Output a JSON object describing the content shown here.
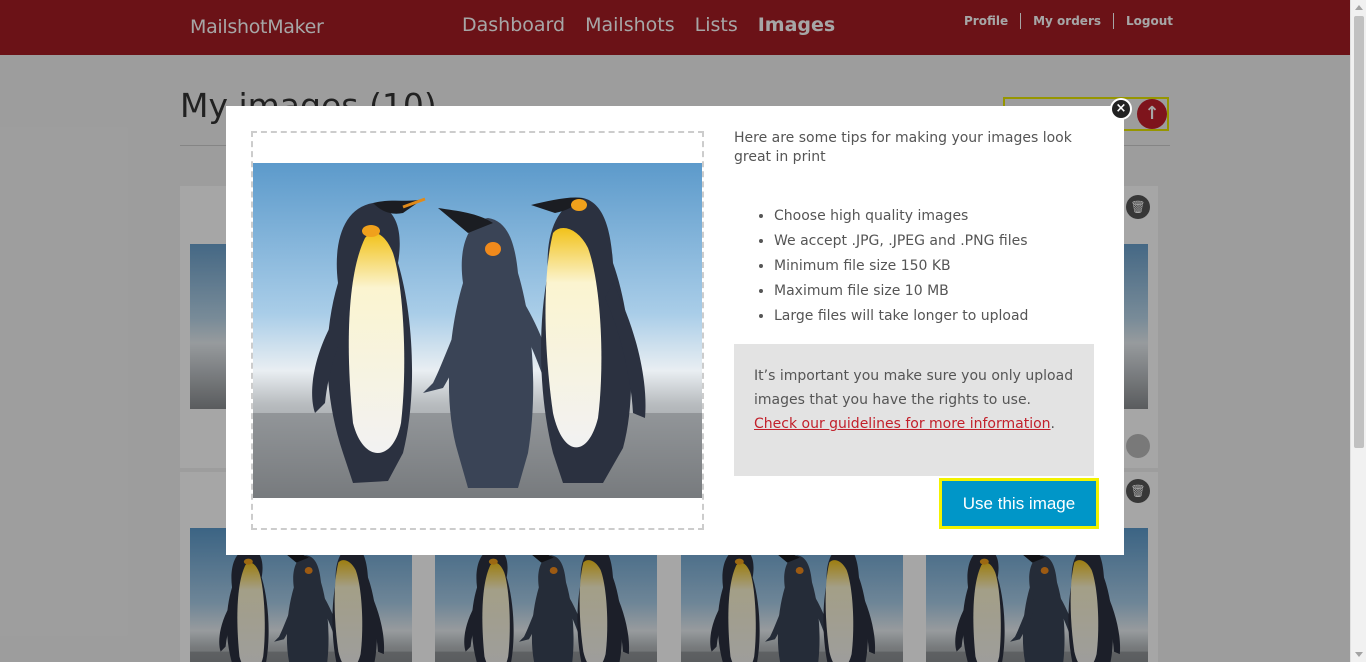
{
  "header": {
    "brand": "MailshotMaker",
    "nav": [
      {
        "label": "Dashboard",
        "active": false
      },
      {
        "label": "Mailshots",
        "active": false
      },
      {
        "label": "Lists",
        "active": false
      },
      {
        "label": "Images",
        "active": true
      }
    ],
    "user_links": [
      "Profile",
      "My orders",
      "Logout"
    ]
  },
  "page": {
    "title": "My images (10)",
    "upload_icon": "upload-arrow-icon",
    "delete_icon": "trash-icon"
  },
  "modal": {
    "close_label": "×",
    "tips_heading": "Here are some tips for making your images look great in print",
    "tips": [
      "Choose high quality images",
      "We accept .JPG, .JPEG and .PNG files",
      "Minimum file size 150 KB",
      "Maximum file size 10 MB",
      "Large files will take longer to upload"
    ],
    "notice_text": "It’s important you make sure you only upload images that you have the rights to use.",
    "notice_link": "Check our guidelines for more information",
    "notice_end": ".",
    "use_button": "Use this image",
    "preview_subject": "penguins-photo"
  },
  "colors": {
    "header_bg": "#a51c24",
    "accent_red": "#c2202b",
    "button_blue": "#0096c8",
    "focus_yellow": "#f2f200"
  }
}
